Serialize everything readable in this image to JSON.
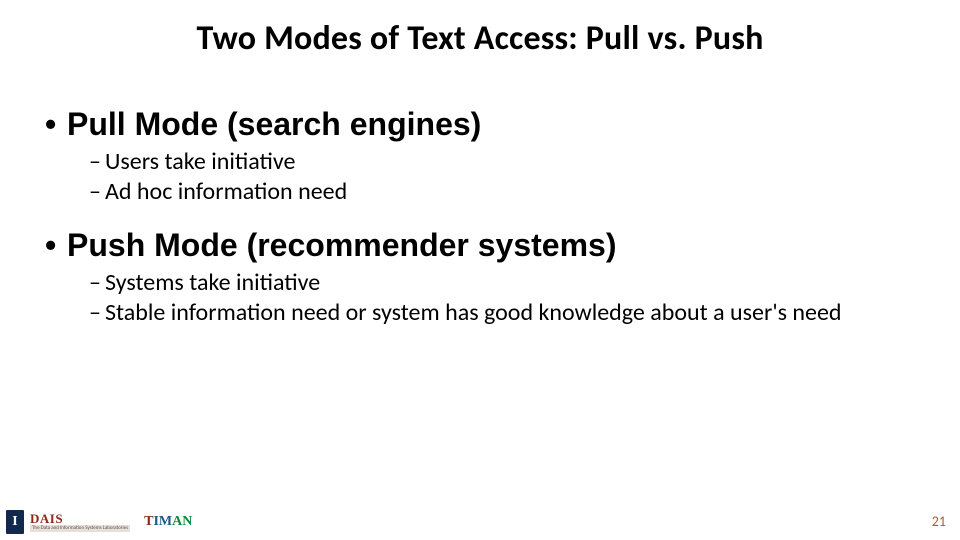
{
  "title": "Two Modes of Text Access: Pull vs. Push",
  "bullets": {
    "l1_1": "Pull Mode (search engines)",
    "l1_1_sub": [
      "Users take initiative",
      "Ad hoc information need"
    ],
    "l1_2": "Push Mode (recommender systems)",
    "l1_2_sub": [
      "Systems take initiative",
      "Stable information need or system has good knowledge about a user's need"
    ]
  },
  "page_number": "21",
  "footer": {
    "illinois_glyph": "I",
    "dais_label": "DAIS",
    "dais_sub": "The Data and Information Systems Laboratories",
    "timan_t": "T",
    "timan_im": "IM",
    "timan_an": "AN"
  }
}
